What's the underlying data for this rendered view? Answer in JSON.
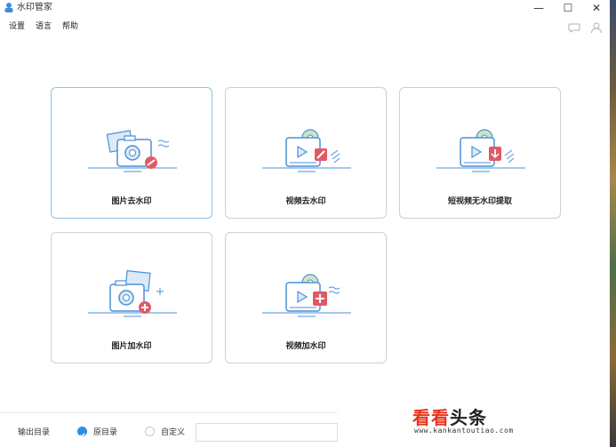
{
  "window": {
    "title": "水印管家"
  },
  "titlebar": {
    "minimize": "—",
    "maximize": "☐",
    "close": "✕"
  },
  "menu": {
    "items": [
      "设置",
      "语言",
      "帮助"
    ]
  },
  "cards": [
    {
      "label": "图片去水印"
    },
    {
      "label": "视频去水印"
    },
    {
      "label": "短视频无水印提取"
    },
    {
      "label": "图片加水印"
    },
    {
      "label": "视频加水印"
    }
  ],
  "footer": {
    "output_label": "输出目录",
    "option_original": "原目录",
    "option_custom": "自定义",
    "path_value": ""
  },
  "watermark": {
    "part1": "看看",
    "part2": "头条",
    "url": "www.kankantoutiao.com"
  },
  "colors": {
    "accent": "#2f8fe0",
    "icon_blue": "#4a90d9",
    "icon_red": "#e05a64",
    "card_active_border": "#8ec3e6"
  }
}
